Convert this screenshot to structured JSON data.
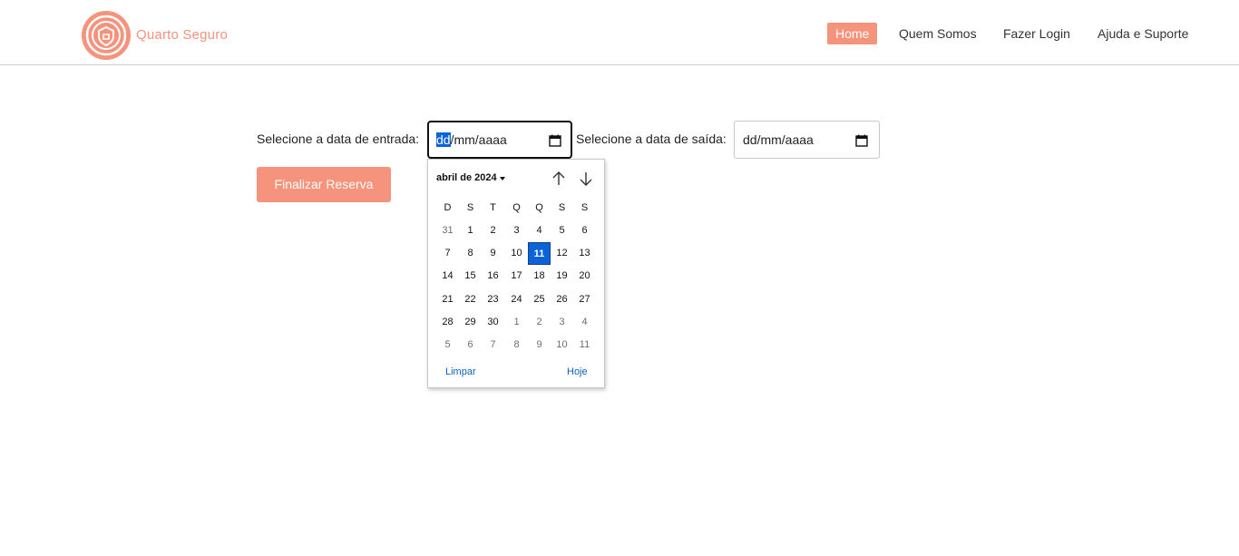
{
  "brand": {
    "name": "Quarto Seguro",
    "color": "#f5937c"
  },
  "nav": {
    "items": [
      {
        "label": "Home",
        "active": true
      },
      {
        "label": "Quem Somos"
      },
      {
        "label": "Fazer Login"
      },
      {
        "label": "Ajuda e Suporte"
      }
    ]
  },
  "form": {
    "entry_label": "Selecione a data de entrada:",
    "entry_value": {
      "day": "dd",
      "rest": "/mm/aaaa"
    },
    "exit_label": "Selecione a data de saída:",
    "exit_value": "dd/mm/aaaa",
    "submit_label": "Finalizar Reserva",
    "calendar_icon": "calendar-icon"
  },
  "datepicker": {
    "month_label": "abril de 2024",
    "weekdays": [
      "D",
      "S",
      "T",
      "Q",
      "Q",
      "S",
      "S"
    ],
    "weeks": [
      [
        "31",
        "1",
        "2",
        "3",
        "4",
        "5",
        "6"
      ],
      [
        "7",
        "8",
        "9",
        "10",
        "11",
        "12",
        "13"
      ],
      [
        "14",
        "15",
        "16",
        "17",
        "18",
        "19",
        "20"
      ],
      [
        "21",
        "22",
        "23",
        "24",
        "25",
        "26",
        "27"
      ],
      [
        "28",
        "29",
        "30",
        "1",
        "2",
        "3",
        "4"
      ],
      [
        "5",
        "6",
        "7",
        "8",
        "9",
        "10",
        "11"
      ]
    ],
    "muted": [
      [
        0,
        0
      ],
      [
        4,
        3
      ],
      [
        4,
        4
      ],
      [
        4,
        5
      ],
      [
        4,
        6
      ],
      [
        5,
        0
      ],
      [
        5,
        1
      ],
      [
        5,
        2
      ],
      [
        5,
        3
      ],
      [
        5,
        4
      ],
      [
        5,
        5
      ],
      [
        5,
        6
      ]
    ],
    "today": [
      1,
      4
    ],
    "clear_label": "Limpar",
    "today_label": "Hoje",
    "selected_color": "#0a63d8"
  }
}
